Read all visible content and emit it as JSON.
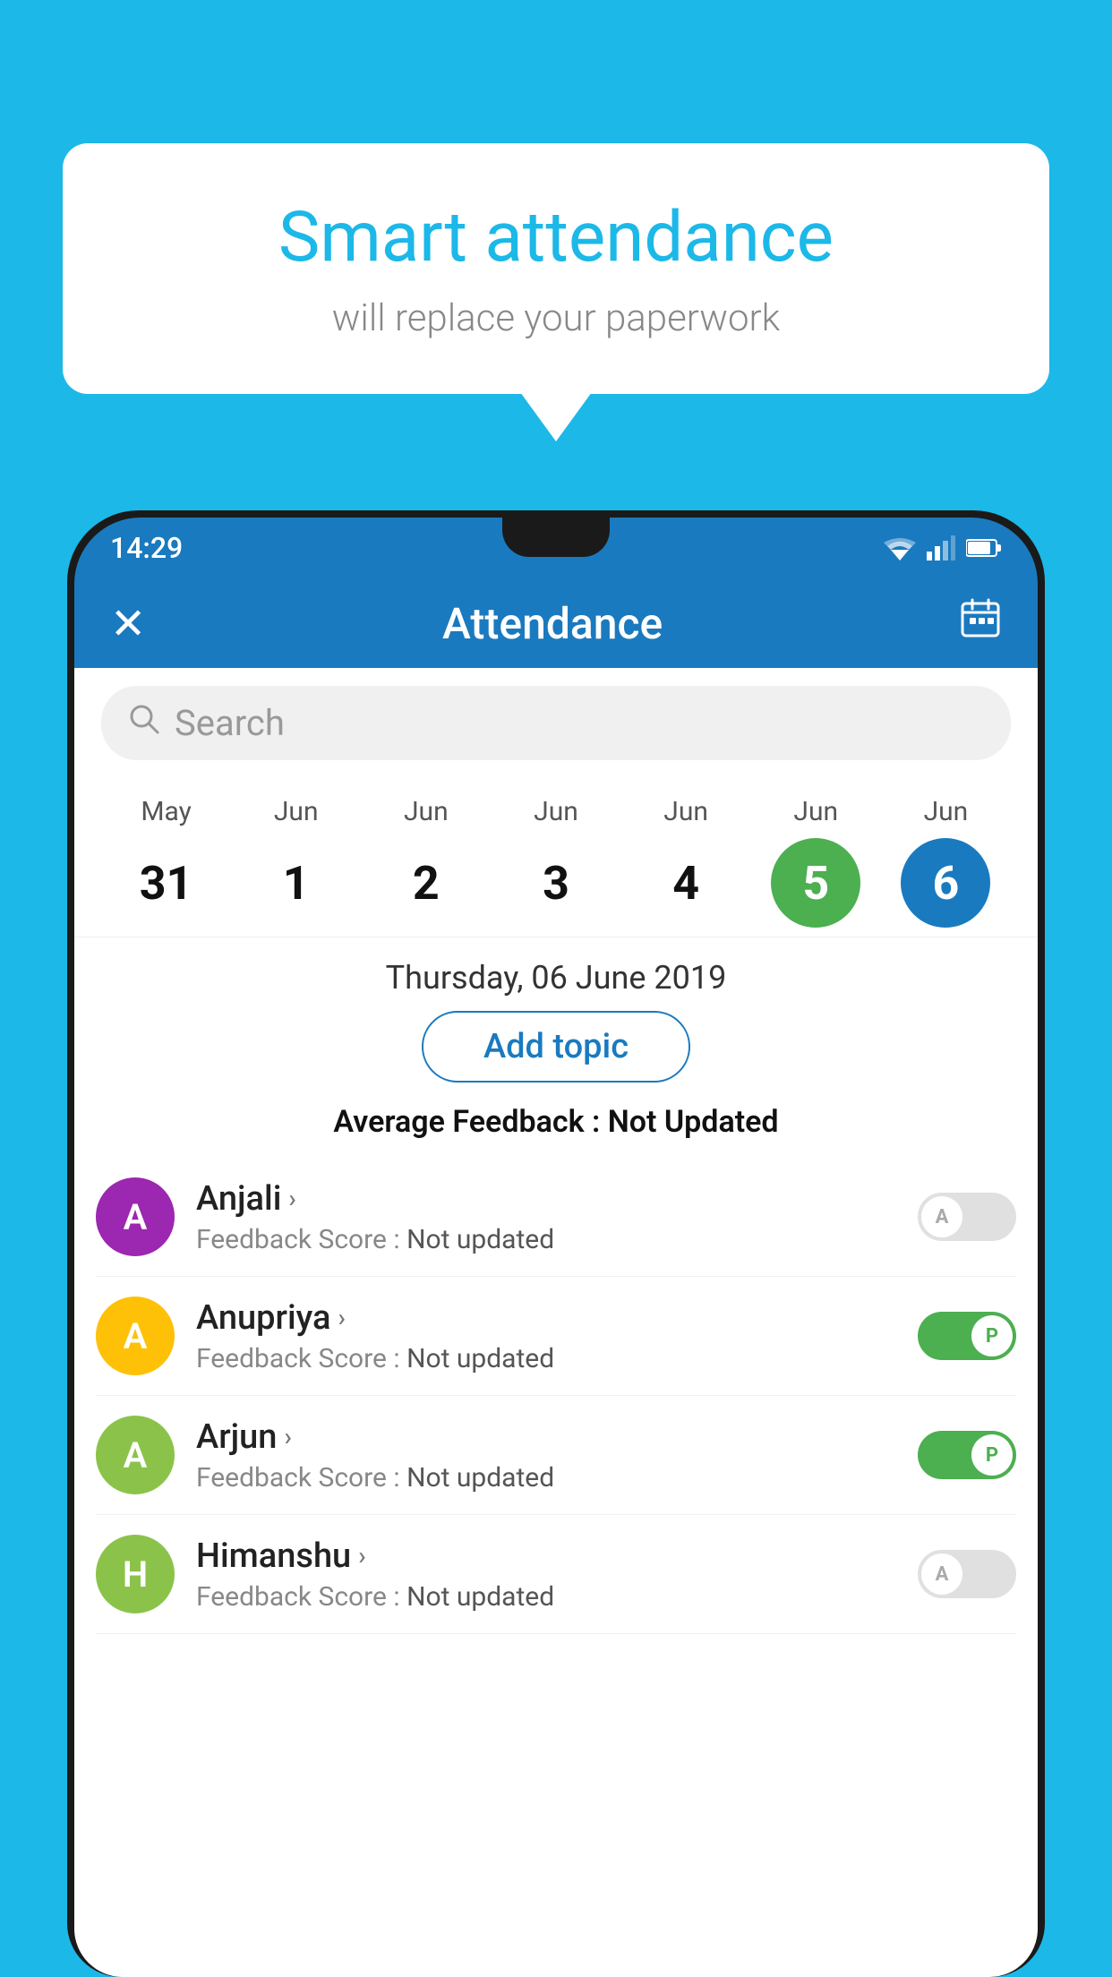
{
  "background_color": "#1cb8e8",
  "speech_bubble": {
    "title": "Smart attendance",
    "subtitle": "will replace your paperwork"
  },
  "status_bar": {
    "time": "14:29"
  },
  "app_bar": {
    "title": "Attendance",
    "close_label": "✕",
    "calendar_icon": "📅"
  },
  "search": {
    "placeholder": "Search"
  },
  "calendar": {
    "days": [
      {
        "month": "May",
        "date": "31",
        "style": "normal"
      },
      {
        "month": "Jun",
        "date": "1",
        "style": "normal"
      },
      {
        "month": "Jun",
        "date": "2",
        "style": "normal"
      },
      {
        "month": "Jun",
        "date": "3",
        "style": "normal"
      },
      {
        "month": "Jun",
        "date": "4",
        "style": "normal"
      },
      {
        "month": "Jun",
        "date": "5",
        "style": "green"
      },
      {
        "month": "Jun",
        "date": "6",
        "style": "blue"
      }
    ]
  },
  "selected_date": "Thursday, 06 June 2019",
  "add_topic_label": "Add topic",
  "avg_feedback_label": "Average Feedback :",
  "avg_feedback_value": "Not Updated",
  "students": [
    {
      "name": "Anjali",
      "avatar_letter": "A",
      "avatar_color": "#9c27b0",
      "feedback_label": "Feedback Score : ",
      "feedback_value": "Not updated",
      "toggle_state": "off",
      "toggle_letter": "A"
    },
    {
      "name": "Anupriya",
      "avatar_letter": "A",
      "avatar_color": "#ffc107",
      "feedback_label": "Feedback Score : ",
      "feedback_value": "Not updated",
      "toggle_state": "on",
      "toggle_letter": "P"
    },
    {
      "name": "Arjun",
      "avatar_letter": "A",
      "avatar_color": "#8bc34a",
      "feedback_label": "Feedback Score : ",
      "feedback_value": "Not updated",
      "toggle_state": "on",
      "toggle_letter": "P"
    },
    {
      "name": "Himanshu",
      "avatar_letter": "H",
      "avatar_color": "#8bc34a",
      "feedback_label": "Feedback Score : ",
      "feedback_value": "Not updated",
      "toggle_state": "off",
      "toggle_letter": "A"
    }
  ]
}
